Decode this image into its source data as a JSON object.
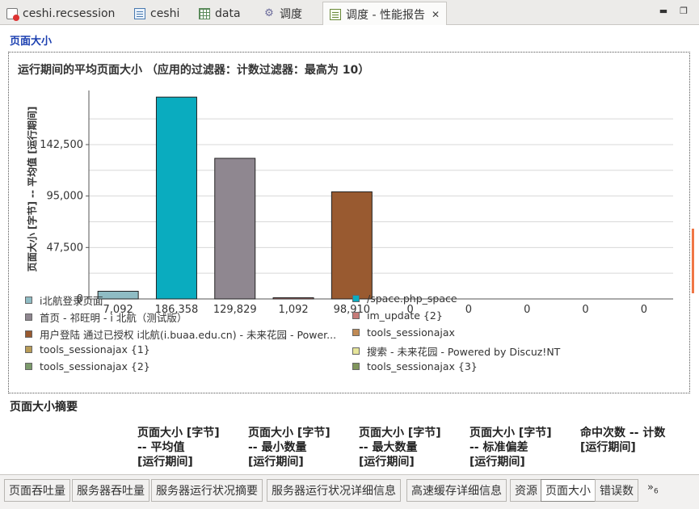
{
  "tabs": [
    {
      "label": "ceshi.recsession",
      "icon": "session-file-icon",
      "active": false
    },
    {
      "label": "ceshi",
      "icon": "script-icon",
      "active": false
    },
    {
      "label": "data",
      "icon": "table-icon",
      "active": false
    },
    {
      "label": "调度",
      "icon": "schedule-icon",
      "active": false
    },
    {
      "label": "调度 - 性能报告",
      "icon": "report-icon",
      "active": true
    }
  ],
  "section_title": "页面大小",
  "chart_data": {
    "type": "bar",
    "title": "运行期间的平均页面大小 （应用的过滤器：计数过滤器：最高为 10）",
    "ylabel": "页面大小 [字节] -- 平均值 [运行期间]",
    "xlabel": "",
    "ylim": [
      0,
      185000
    ],
    "yticks": [
      0,
      47500,
      95000,
      142500
    ],
    "ytick_labels": [
      "0",
      "47,500",
      "95,000",
      "142,500"
    ],
    "grid": true,
    "categories": [
      "7,092",
      "186,358",
      "129,829",
      "1,092",
      "98,910",
      "0",
      "0",
      "0",
      "0",
      "0"
    ],
    "values": [
      7092,
      186358,
      129829,
      1092,
      98910,
      0,
      0,
      0,
      0,
      0
    ],
    "colors": [
      "#8fbcc4",
      "#0aacbf",
      "#8f8790",
      "#c67b78",
      "#995a30",
      "#c08a55",
      "#b89c58",
      "#e6e59a",
      "#7c9b6c",
      "#80955c"
    ],
    "legend": [
      {
        "label": "i北航登录页面",
        "color": "#8fbcc4"
      },
      {
        "label": "/space.php_space",
        "color": "#0aacbf"
      },
      {
        "label": "首页 - 祁旺明 - i 北航（测试版）",
        "color": "#8f8790"
      },
      {
        "label": "im_update {2}",
        "color": "#c67b78"
      },
      {
        "label": "用户登陆  通过已授权 i北航(i.buaa.edu.cn) - 未来花园  - Power...",
        "color": "#995a30"
      },
      {
        "label": "tools_sessionajax",
        "color": "#c08a55"
      },
      {
        "label": "tools_sessionajax {1}",
        "color": "#b89c58"
      },
      {
        "label": "搜索 - 未来花园  - Powered by Discuz!NT",
        "color": "#e6e59a"
      },
      {
        "label": "tools_sessionajax {2}",
        "color": "#7c9b6c"
      },
      {
        "label": "tools_sessionajax {3}",
        "color": "#80955c"
      }
    ],
    "legend_position": "bottom"
  },
  "summary": {
    "title": "页面大小摘要",
    "columns": [
      "页面大小 [字节]\n-- 平均值\n[运行期间]",
      "页面大小 [字节]\n-- 最小数量\n[运行期间]",
      "页面大小 [字节]\n-- 最大数量\n[运行期间]",
      "页面大小 [字节]\n-- 标准偏差\n[运行期间]",
      "命中次数 -- 计数\n[运行期间]"
    ]
  },
  "bottom_tabs": [
    {
      "label": "页面吞吐量",
      "active": false
    },
    {
      "label": "服务器吞吐量",
      "active": false
    },
    {
      "label": "服务器运行状况摘要",
      "active": false
    },
    {
      "label": "服务器运行状况详细信息",
      "active": false
    },
    {
      "label": "高速缓存详细信息",
      "active": false
    },
    {
      "label": "资源",
      "active": false
    },
    {
      "label": "页面大小",
      "active": true
    },
    {
      "label": "错误数",
      "active": false
    }
  ],
  "more_tabs": {
    "symbol": "»",
    "count": "6"
  }
}
